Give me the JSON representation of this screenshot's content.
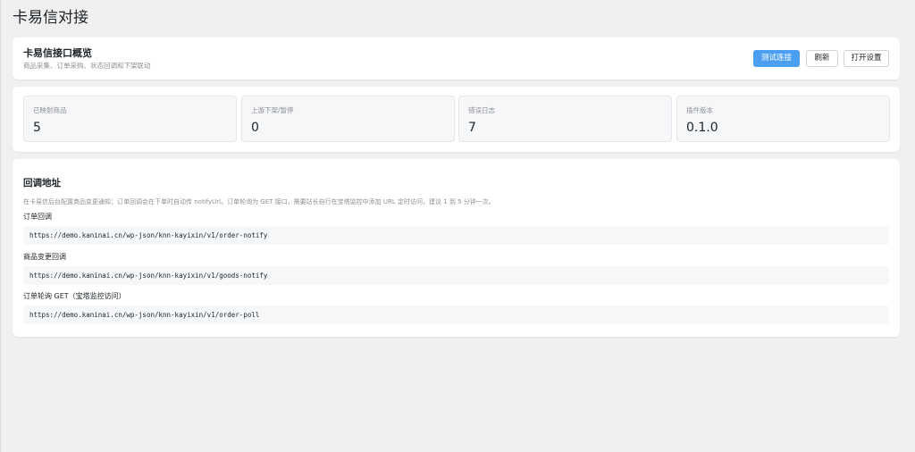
{
  "page": {
    "title": "卡易信对接"
  },
  "overview": {
    "title": "卡易信接口概览",
    "subtitle": "商品采集、订单采购、状态回调和下架联动",
    "buttons": {
      "test": "测试连接",
      "refresh": "刷新",
      "settings": "打开设置"
    },
    "accent_color": "#4b9ff2"
  },
  "stats": [
    {
      "label": "已映射商品",
      "value": "5"
    },
    {
      "label": "上游下架/暂停",
      "value": "0"
    },
    {
      "label": "错误日志",
      "value": "7"
    },
    {
      "label": "插件版本",
      "value": "0.1.0"
    }
  ],
  "callback": {
    "title": "回调地址",
    "description": "在卡易信后台配置商品变更通知；订单回调会在下单时自动传 notifyUrl。订单轮询为 GET 接口，需要站长自行在宝塔监控中添加 URL 定时访问，建议 1 到 5 分钟一次。",
    "items": [
      {
        "label": "订单回调",
        "url": "https://demo.kaninai.cn/wp-json/knn-kayixin/v1/order-notify"
      },
      {
        "label": "商品变更回调",
        "url": "https://demo.kaninai.cn/wp-json/knn-kayixin/v1/goods-notify"
      },
      {
        "label": "订单轮询 GET（宝塔监控访问）",
        "url": "https://demo.kaninai.cn/wp-json/knn-kayixin/v1/order-poll"
      }
    ]
  }
}
